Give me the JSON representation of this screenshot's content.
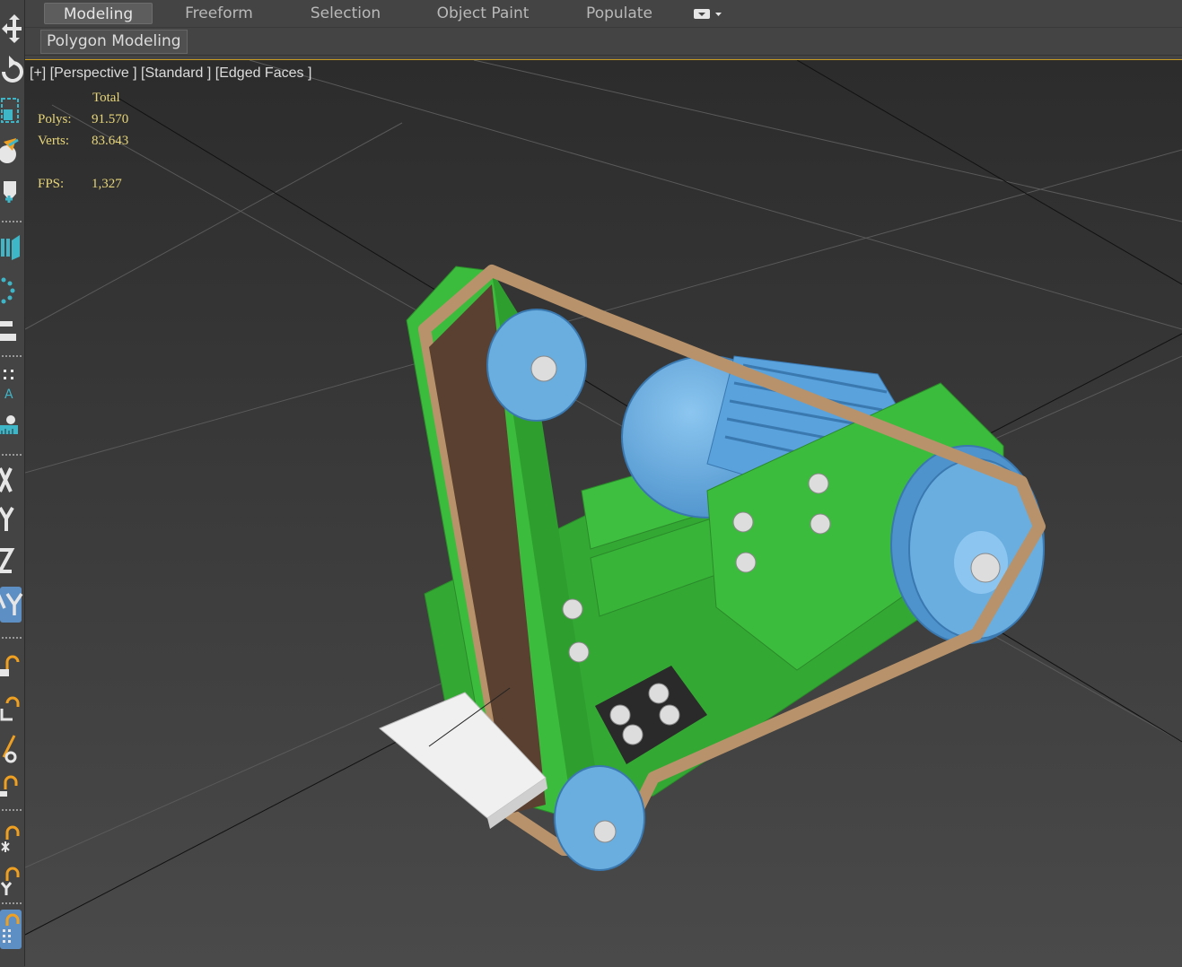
{
  "ribbon": {
    "tabs": [
      {
        "label": "Modeling",
        "active": true
      },
      {
        "label": "Freeform",
        "active": false
      },
      {
        "label": "Selection",
        "active": false
      },
      {
        "label": "Object Paint",
        "active": false
      },
      {
        "label": "Populate",
        "active": false
      }
    ],
    "options_icon": "display-dropdown-icon",
    "panel_tab": "Polygon Modeling"
  },
  "toolbar": {
    "tools": [
      {
        "icon": "move-icon"
      },
      {
        "icon": "rotate-icon"
      },
      {
        "icon": "scale-icon"
      },
      {
        "icon": "select-place-icon"
      },
      {
        "icon": "place-object-icon"
      },
      {
        "icon": "mirror-icon"
      },
      {
        "icon": "array-icon"
      },
      {
        "icon": "align-icon"
      },
      {
        "icon": "snap-spacing-icon"
      },
      {
        "icon": "measure-icon"
      },
      {
        "icon": "axis-x-icon"
      },
      {
        "icon": "axis-y-icon"
      },
      {
        "icon": "axis-z-icon"
      },
      {
        "icon": "axis-xy-icon",
        "active": true
      },
      {
        "icon": "link-icon"
      },
      {
        "icon": "unlink-icon"
      },
      {
        "icon": "bind-space-warp-icon"
      },
      {
        "icon": "hierarchy-link-icon"
      },
      {
        "icon": "bone-link-icon"
      },
      {
        "icon": "light-link-icon"
      },
      {
        "icon": "grid-snap-icon",
        "active": true
      }
    ]
  },
  "viewport": {
    "label": "[+] [Perspective ] [Standard ] [Edged Faces ]",
    "stats": {
      "total_label": "Total",
      "polys_label": "Polys:",
      "polys_value": "91.570",
      "verts_label": "Verts:",
      "verts_value": "83.643",
      "fps_label": "FPS:",
      "fps_value": "1,327"
    }
  },
  "colors": {
    "accent_border": "#c79a22",
    "stats_text": "#e8d67a",
    "frame_green": "#38b538",
    "pulley_blue": "#6aaee0",
    "belt_tan": "#b8926a",
    "icon_teal": "#3fb6c8"
  }
}
